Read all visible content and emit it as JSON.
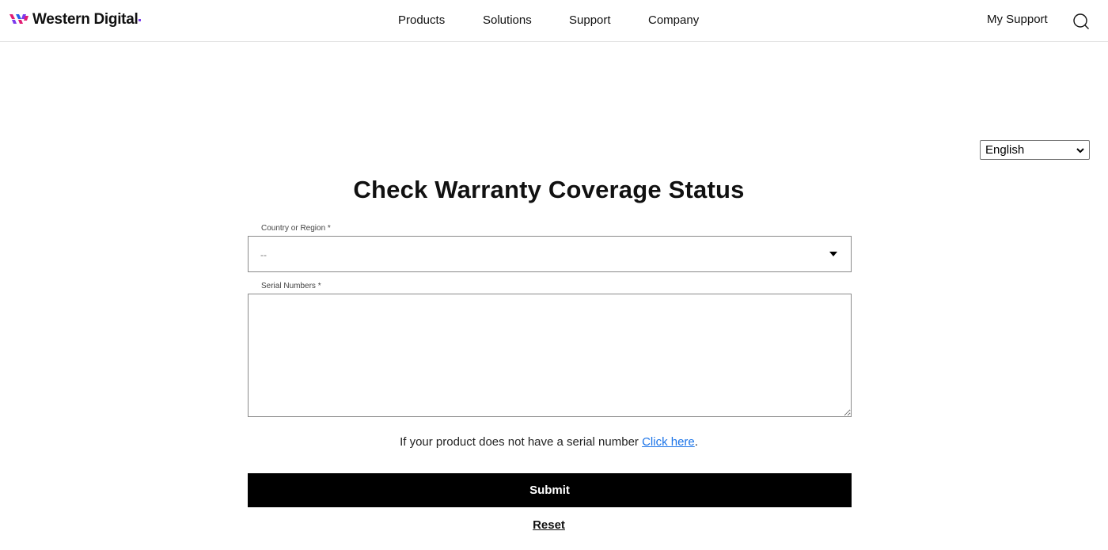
{
  "header": {
    "brand": "Western Digital",
    "nav": [
      "Products",
      "Solutions",
      "Support",
      "Company"
    ],
    "my_support": "My Support",
    "search_icon": "search-icon"
  },
  "language": {
    "selected": "English"
  },
  "form": {
    "title": "Check Warranty Coverage Status",
    "country_label": "Country or Region *",
    "country_value": "--",
    "serial_label": "Serial Numbers *",
    "serial_value": "",
    "hint_text": "If your product does not have a serial number ",
    "hint_link": "Click here",
    "hint_suffix": ".",
    "submit_label": "Submit",
    "reset_label": "Reset"
  },
  "colors": {
    "brand_purple": "#7c3aed",
    "brand_pink": "#e11d74",
    "link": "#1a73e8",
    "button": "#000000"
  }
}
